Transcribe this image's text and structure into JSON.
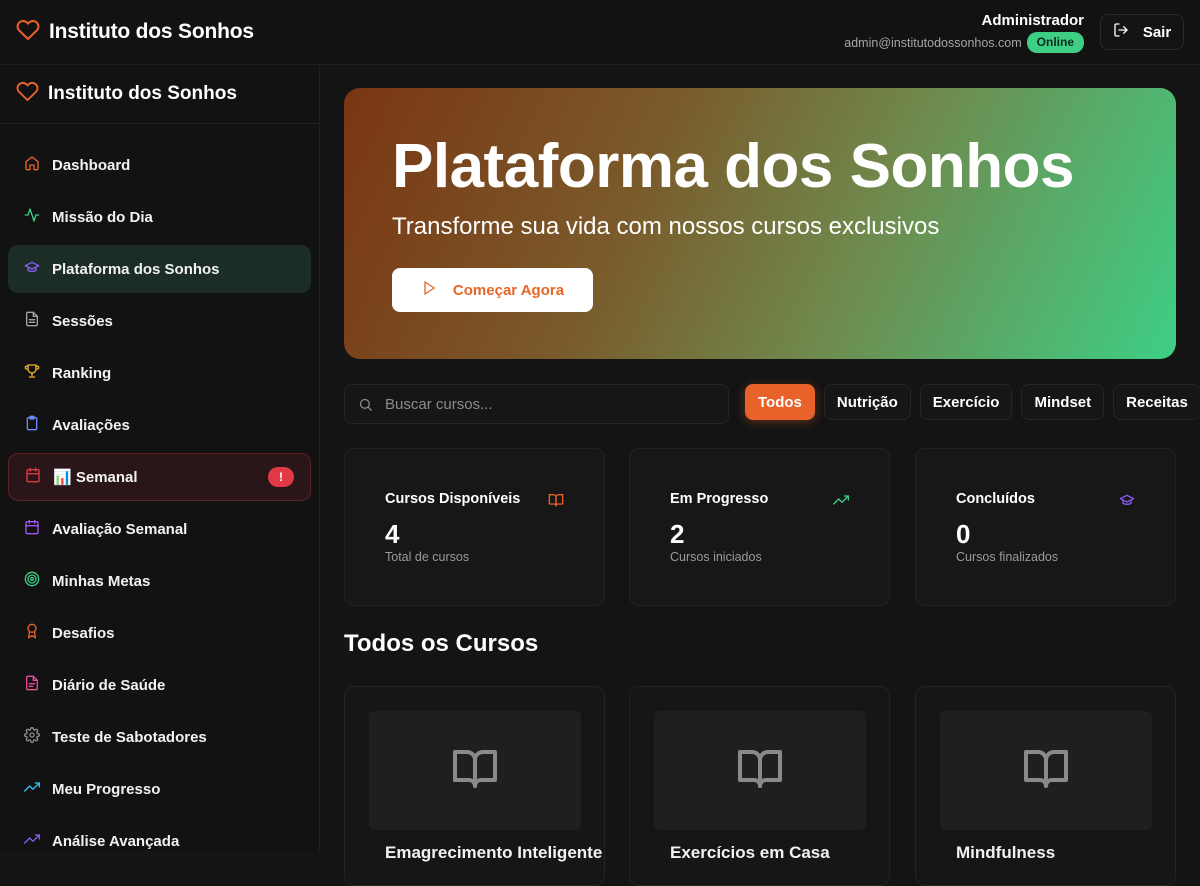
{
  "app": {
    "brand": "Instituto dos Sonhos"
  },
  "user": {
    "name": "Administrador",
    "email": "admin@institutodossonhos.com",
    "status": "Online",
    "logout_label": "Sair"
  },
  "sidebar": {
    "brand": "Instituto dos Sonhos",
    "items": [
      {
        "label": "Dashboard",
        "icon": "home-icon",
        "color": "#e8622a"
      },
      {
        "label": "Missão do Dia",
        "icon": "activity-icon",
        "color": "#3ecf85"
      },
      {
        "label": "Plataforma dos Sonhos",
        "icon": "graduation-cap-icon",
        "color": "#8b5cf6",
        "active": true
      },
      {
        "label": "Sessões",
        "icon": "file-text-icon",
        "color": "#a3a3a3"
      },
      {
        "label": "Ranking",
        "icon": "trophy-icon",
        "color": "#f0b429"
      },
      {
        "label": "Avaliações",
        "icon": "clipboard-icon",
        "color": "#6b8cff"
      },
      {
        "label": "📊 Semanal",
        "icon": "calendar-icon",
        "color": "#e03a47",
        "badge": "!",
        "alert": true
      },
      {
        "label": "Avaliação Semanal",
        "icon": "calendar-icon",
        "color": "#a855f7"
      },
      {
        "label": "Minhas Metas",
        "icon": "target-icon",
        "color": "#3ecf85"
      },
      {
        "label": "Desafios",
        "icon": "award-icon",
        "color": "#e8622a"
      },
      {
        "label": "Diário de Saúde",
        "icon": "file-icon",
        "color": "#ec4899"
      },
      {
        "label": "Teste de Sabotadores",
        "icon": "gear-icon",
        "color": "#8c8c8c"
      },
      {
        "label": "Meu Progresso",
        "icon": "trending-up-icon",
        "color": "#38bdf8"
      },
      {
        "label": "Análise Avançada",
        "icon": "trending-up-icon",
        "color": "#8b5cf6"
      }
    ]
  },
  "hero": {
    "title": "Plataforma dos Sonhos",
    "subtitle": "Transforme sua vida com nossos cursos exclusivos",
    "cta_label": "Começar Agora"
  },
  "search": {
    "placeholder": "Buscar cursos..."
  },
  "filters": [
    "Todos",
    "Nutrição",
    "Exercício",
    "Mindset",
    "Receitas"
  ],
  "stats": [
    {
      "title": "Cursos Disponíveis",
      "value": "4",
      "caption": "Total de cursos",
      "icon": "book-open-icon",
      "color": "#e8622a"
    },
    {
      "title": "Em Progresso",
      "value": "2",
      "caption": "Cursos iniciados",
      "icon": "trending-up-icon",
      "color": "#3ecf85"
    },
    {
      "title": "Concluídos",
      "value": "0",
      "caption": "Cursos finalizados",
      "icon": "graduation-cap-icon",
      "color": "#8b5cf6"
    }
  ],
  "courses_section": {
    "title": "Todos os Cursos",
    "courses": [
      {
        "title": "Emagrecimento Inteligente"
      },
      {
        "title": "Exercícios em Casa"
      },
      {
        "title": "Mindfulness"
      }
    ]
  }
}
